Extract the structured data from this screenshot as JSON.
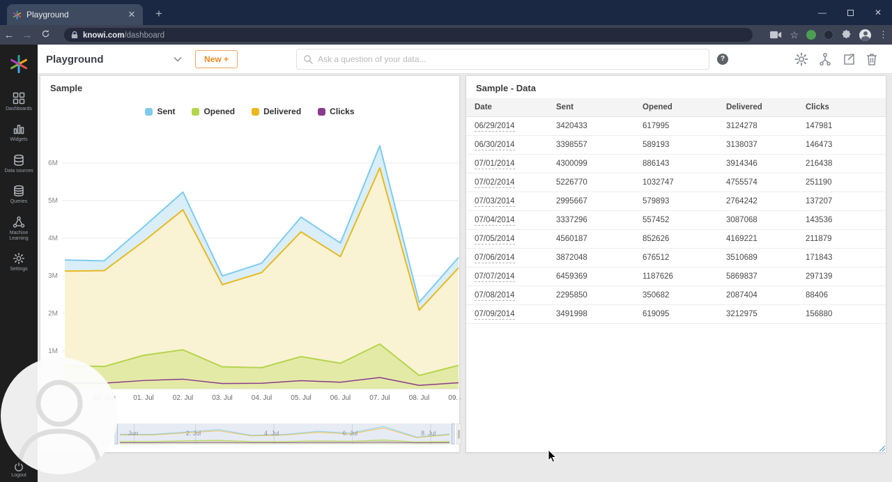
{
  "browser": {
    "tab_title": "Playground",
    "url_host": "knowi.com",
    "url_path": "/dashboard"
  },
  "header": {
    "workspace_label": "Playground",
    "new_button_label": "New +",
    "search_placeholder": "Ask a question of your data...",
    "help_label": "?"
  },
  "sidebar": {
    "items": [
      {
        "label": "Dashboards",
        "icon": "dashboards-grid-icon"
      },
      {
        "label": "Widgets",
        "icon": "widgets-chart-icon"
      },
      {
        "label": "Data sources",
        "icon": "database-icon"
      },
      {
        "label": "Queries",
        "icon": "queries-database-icon"
      },
      {
        "label": "Machine Learning",
        "icon": "nodes-icon"
      },
      {
        "label": "Settings",
        "icon": "gear-icon"
      }
    ],
    "logout_label": "Logout"
  },
  "chart_card": {
    "title": "Sample"
  },
  "chart_data": {
    "type": "area",
    "title": "Sample",
    "x": [
      "06/29/2014",
      "06/30/2014",
      "07/01/2014",
      "07/02/2014",
      "07/03/2014",
      "07/04/2014",
      "07/05/2014",
      "07/06/2014",
      "07/07/2014",
      "07/08/2014",
      "07/09/2014"
    ],
    "x_tick_labels": [
      "",
      "30. Jun",
      "01. Jul",
      "02. Jul",
      "03. Jul",
      "04. Jul",
      "05. Jul",
      "06. Jul",
      "07. Jul",
      "08. Jul",
      "09. Jul"
    ],
    "y_ticks": [
      "1M",
      "2M",
      "3M",
      "4M",
      "5M",
      "6M"
    ],
    "ylim": [
      0,
      6500000
    ],
    "grid": true,
    "legend_position": "top",
    "series": [
      {
        "name": "Sent",
        "color": "#7ecbed",
        "fill": "#d9eef9",
        "values": [
          3420433,
          3398557,
          4300099,
          5226770,
          2995667,
          3337296,
          4560187,
          3872048,
          6459369,
          2295850,
          3491998
        ]
      },
      {
        "name": "Opened",
        "color": "#b5d44c",
        "fill": "#e3eaa6",
        "values": [
          617995,
          589193,
          886143,
          1032747,
          579893,
          557452,
          852626,
          676512,
          1187626,
          350682,
          619095
        ]
      },
      {
        "name": "Delivered",
        "color": "#e9b820",
        "fill": "#f9f3d3",
        "values": [
          3124278,
          3138037,
          3914346,
          4755574,
          2764242,
          3087068,
          4169221,
          3510689,
          5869837,
          2087404,
          3212975
        ]
      },
      {
        "name": "Clicks",
        "color": "#8a3a8e",
        "fill": "none",
        "values": [
          147981,
          146473,
          216438,
          251190,
          137207,
          143536,
          211879,
          171843,
          297139,
          88406,
          156880
        ]
      }
    ],
    "navigator": {
      "labels": [
        ". Jun",
        "2. Jul",
        "4. Jul",
        "6. Jul",
        "8. Jul"
      ],
      "positions_pct": [
        3,
        21,
        44,
        67,
        90
      ]
    }
  },
  "table_card": {
    "title": "Sample - Data",
    "columns": [
      "Date",
      "Sent",
      "Opened",
      "Delivered",
      "Clicks"
    ],
    "rows": [
      [
        "06/29/2014",
        "3420433",
        "617995",
        "3124278",
        "147981"
      ],
      [
        "06/30/2014",
        "3398557",
        "589193",
        "3138037",
        "146473"
      ],
      [
        "07/01/2014",
        "4300099",
        "886143",
        "3914346",
        "216438"
      ],
      [
        "07/02/2014",
        "5226770",
        "1032747",
        "4755574",
        "251190"
      ],
      [
        "07/03/2014",
        "2995667",
        "579893",
        "2764242",
        "137207"
      ],
      [
        "07/04/2014",
        "3337296",
        "557452",
        "3087068",
        "143536"
      ],
      [
        "07/05/2014",
        "4560187",
        "852626",
        "4169221",
        "211879"
      ],
      [
        "07/06/2014",
        "3872048",
        "676512",
        "3510689",
        "171843"
      ],
      [
        "07/07/2014",
        "6459369",
        "1187626",
        "5869837",
        "297139"
      ],
      [
        "07/08/2014",
        "2295850",
        "350682",
        "2087404",
        "88406"
      ],
      [
        "07/09/2014",
        "3491998",
        "619095",
        "3212975",
        "156880"
      ]
    ]
  }
}
